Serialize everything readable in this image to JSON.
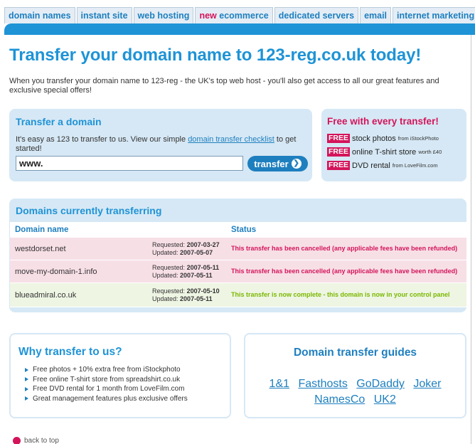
{
  "nav": {
    "tabs": [
      {
        "label": "domain names"
      },
      {
        "label": "instant site"
      },
      {
        "label": "web hosting"
      },
      {
        "prefix": "new",
        "label": "ecommerce"
      },
      {
        "label": "dedicated servers"
      },
      {
        "label": "email"
      },
      {
        "label": "internet marketing"
      }
    ]
  },
  "page": {
    "title": "Transfer your domain name to 123-reg.co.uk today!",
    "intro": "When you transfer your domain name to 123-reg - the UK's top web host - you'll also get access to all our great features and exclusive special offers!"
  },
  "transfer": {
    "title": "Transfer a domain",
    "text_before": "It's easy as 123 to transfer to us. View our simple ",
    "link": "domain transfer checklist",
    "text_after": " to get started!",
    "input_value": "www.",
    "button": "transfer",
    "button_icon": "arrow-right-icon"
  },
  "free": {
    "title": "Free with every transfer!",
    "badge": "FREE",
    "items": [
      {
        "text": "stock photos",
        "from": "from iStockPhoto"
      },
      {
        "text": "online T-shirt store",
        "from": "worth £40"
      },
      {
        "text": "DVD rental",
        "from": "from LoveFilm.com"
      }
    ]
  },
  "domains_transferring": {
    "title": "Domains currently transferring",
    "columns": {
      "domain": "Domain name",
      "status": "Status"
    },
    "requested_label": "Requested:",
    "updated_label": "Updated:",
    "rows": [
      {
        "domain": "westdorset.net",
        "requested": "2007-03-27",
        "updated": "2007-05-07",
        "status": "This transfer has been cancelled (any applicable fees have been refunded)",
        "state": "cancelled"
      },
      {
        "domain": "move-my-domain-1.info",
        "requested": "2007-05-11",
        "updated": "2007-05-11",
        "status": "This transfer has been cancelled (any applicable fees have been refunded)",
        "state": "cancelled"
      },
      {
        "domain": "blueadmiral.co.uk",
        "requested": "2007-05-10",
        "updated": "2007-05-11",
        "status": "This transfer is now complete - this domain is now in your control panel",
        "state": "complete"
      }
    ]
  },
  "why": {
    "title": "Why transfer to us?",
    "items": [
      "Free photos + 10% extra free from iStockphoto",
      "Free online T-shirt store from spreadshirt.co.uk",
      "Free DVD rental for 1 month from LoveFilm.com",
      "Great management features plus exclusive offers"
    ]
  },
  "guides": {
    "title": "Domain transfer guides",
    "links": [
      "1&1",
      "Fasthosts",
      "GoDaddy",
      "Joker",
      "NamesCo",
      "UK2"
    ]
  },
  "footer": {
    "back_to_top": "back to top",
    "back_icon": "up-arrow-icon"
  },
  "colors": {
    "brand_blue": "#1e93d6",
    "accent_pink": "#d4145a",
    "success_green": "#7ab800",
    "panel_bg": "#d6e8f5"
  }
}
